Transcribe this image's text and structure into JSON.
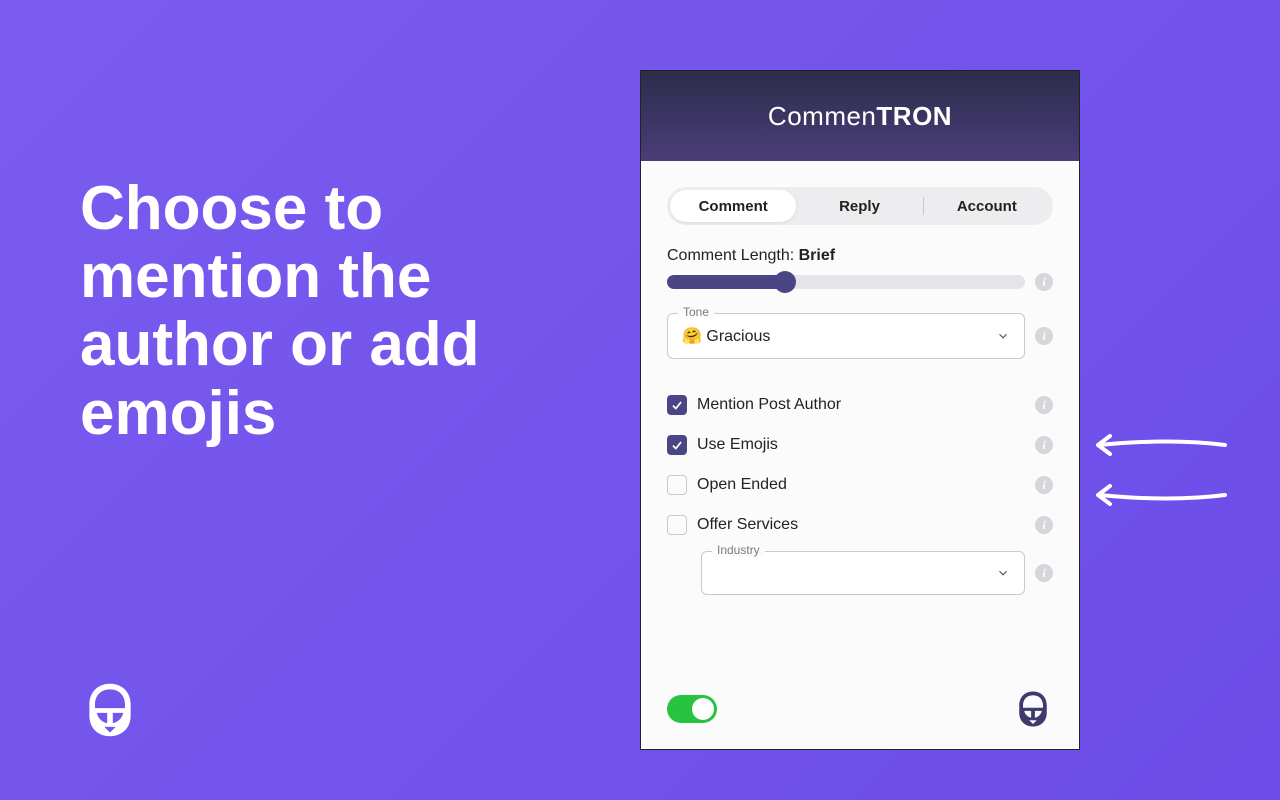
{
  "headline": "Choose to mention the author or add emojis",
  "panel": {
    "title_thin": "Commen",
    "title_bold": "TRON",
    "tabs": {
      "comment": "Comment",
      "reply": "Reply",
      "account": "Account"
    },
    "length": {
      "label": "Comment Length: ",
      "value": "Brief"
    },
    "tone": {
      "legend": "Tone",
      "emoji": "🤗",
      "value": " Gracious"
    },
    "options": {
      "mention_author": "Mention Post Author",
      "use_emojis": "Use Emojis",
      "open_ended": "Open Ended",
      "offer_services": "Offer Services"
    },
    "industry": {
      "legend": "Industry",
      "value": ""
    }
  }
}
